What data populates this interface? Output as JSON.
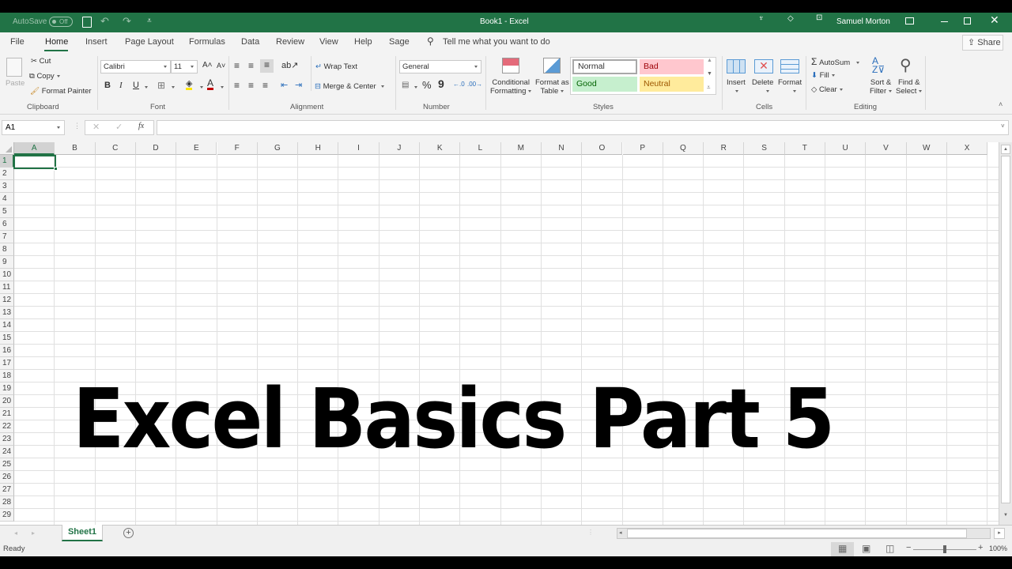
{
  "titlebar": {
    "autosave_label": "AutoSave",
    "autosave_state": "Off",
    "document_title": "Book1 - Excel",
    "user_name": "Samuel Morton"
  },
  "tabs": {
    "items": [
      "File",
      "Home",
      "Insert",
      "Page Layout",
      "Formulas",
      "Data",
      "Review",
      "View",
      "Help",
      "Sage"
    ],
    "active": "Home",
    "tell_me": "Tell me what you want to do",
    "share_label": "Share"
  },
  "ribbon": {
    "clipboard": {
      "paste": "Paste",
      "cut": "Cut",
      "copy": "Copy",
      "format_painter": "Format Painter",
      "group": "Clipboard"
    },
    "font": {
      "name": "Calibri",
      "size": "11",
      "bold": "B",
      "italic": "I",
      "underline": "U",
      "group": "Font"
    },
    "alignment": {
      "wrap_text": "Wrap Text",
      "merge_center": "Merge & Center",
      "group": "Alignment"
    },
    "number": {
      "format": "General",
      "percent": "%",
      "comma": "9",
      "group": "Number"
    },
    "styles": {
      "conditional_1": "Conditional",
      "conditional_2": "Formatting",
      "format_table_1": "Format as",
      "format_table_2": "Table",
      "normal": "Normal",
      "bad": "Bad",
      "good": "Good",
      "neutral": "Neutral",
      "group": "Styles",
      "colors": {
        "normal": "#ffffff",
        "bad": "#ffc7ce",
        "good": "#c6efce",
        "neutral": "#ffeb9c",
        "bad_text": "#9c0006",
        "good_text": "#006100",
        "neutral_text": "#9c5700"
      }
    },
    "cells": {
      "insert": "Insert",
      "delete": "Delete",
      "format": "Format",
      "group": "Cells"
    },
    "editing": {
      "autosum": "AutoSum",
      "fill": "Fill",
      "clear": "Clear",
      "sort_1": "Sort &",
      "sort_2": "Filter",
      "find_1": "Find &",
      "find_2": "Select",
      "group": "Editing"
    }
  },
  "formula_bar": {
    "name_box": "A1",
    "fx": "fx",
    "value": ""
  },
  "grid": {
    "columns": [
      "A",
      "B",
      "C",
      "D",
      "E",
      "F",
      "G",
      "H",
      "I",
      "J",
      "K",
      "L",
      "M",
      "N",
      "O",
      "P",
      "Q",
      "R",
      "S",
      "T",
      "U",
      "V",
      "W",
      "X"
    ],
    "rows": [
      "1",
      "2",
      "3",
      "4",
      "5",
      "6",
      "7",
      "8",
      "9",
      "10",
      "11",
      "12",
      "13",
      "14",
      "15",
      "16",
      "17",
      "18",
      "19",
      "20",
      "21",
      "22",
      "23",
      "24",
      "25",
      "26",
      "27",
      "28",
      "29"
    ],
    "selected_cell": "A1",
    "content_text": "Excel Basics Part 5"
  },
  "sheets": {
    "tabs": [
      "Sheet1"
    ],
    "active": "Sheet1"
  },
  "status": {
    "text": "Ready",
    "zoom": "100%"
  },
  "colors": {
    "accent": "#217346"
  }
}
